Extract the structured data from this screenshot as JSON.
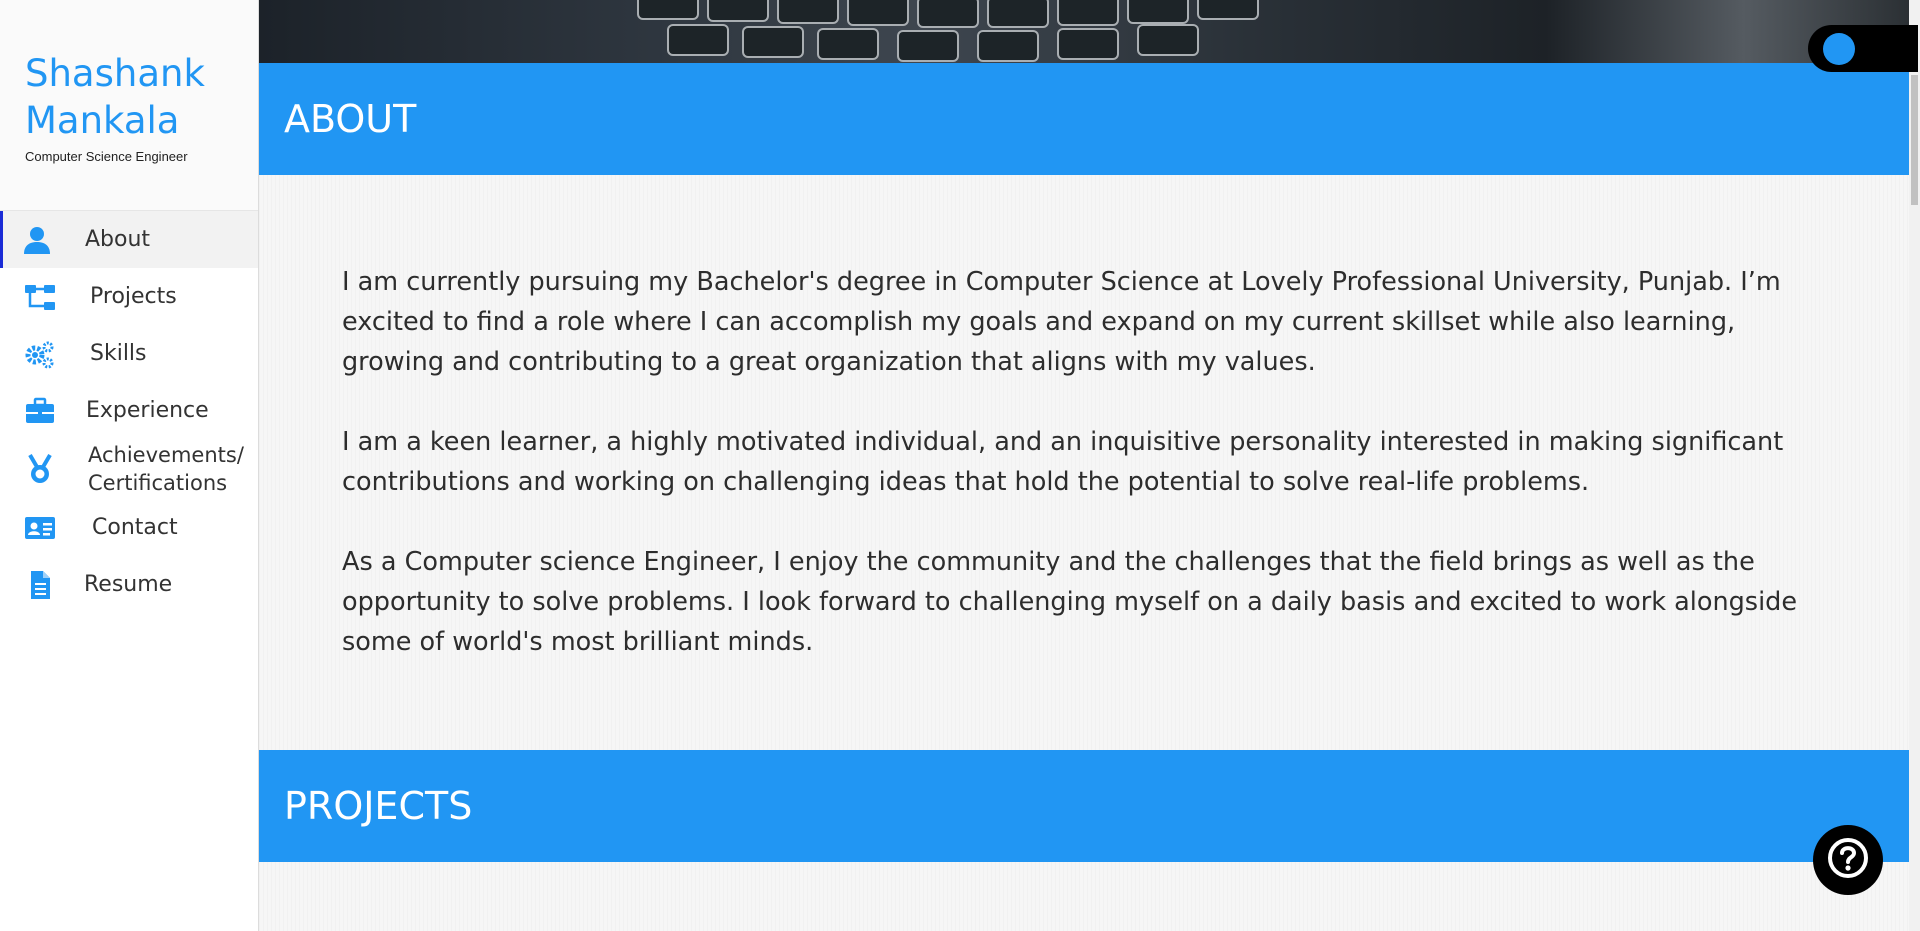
{
  "brand": {
    "name_line1": "Shashank",
    "name_line2": "Mankala",
    "subtitle": "Computer Science Engineer"
  },
  "nav": {
    "items": [
      {
        "label": "About",
        "icon": "user-icon",
        "active": true
      },
      {
        "label": "Projects",
        "icon": "sitemap-icon"
      },
      {
        "label": "Skills",
        "icon": "cogs-icon"
      },
      {
        "label": "Experience",
        "icon": "briefcase-icon"
      },
      {
        "label_line1": "Achievements/",
        "label_line2": "Certifications",
        "icon": "medal-icon"
      },
      {
        "label": "Contact",
        "icon": "address-card-icon"
      },
      {
        "label": "Resume",
        "icon": "file-icon"
      }
    ]
  },
  "sections": {
    "about": {
      "title": "ABOUT",
      "paragraphs": [
        "I am currently pursuing my Bachelor's degree in Computer Science at Lovely Professional University, Punjab. I’m excited to find a role where I can accomplish my goals and expand on my current skillset while also learning, growing and contributing to a great organization that aligns with my values.",
        "I am a keen learner, a highly motivated individual, and an inquisitive personality interested in making significant contributions and working on challenging ideas that hold the potential to solve real-life problems.",
        "As a Computer science Engineer, I enjoy the community and the challenges that the field brings as well as the opportunity to solve problems. I look forward to challenging myself on a daily basis and excited to work alongside some of world's most brilliant minds."
      ]
    },
    "projects": {
      "title": "PROJECTS"
    }
  },
  "colors": {
    "accent": "#2196f3",
    "active_indicator": "#1a2bd6",
    "text": "#2d2d2d"
  },
  "widgets": {
    "theme_toggle_icon": "toggle-switch",
    "help_icon": "question-circle-icon"
  }
}
